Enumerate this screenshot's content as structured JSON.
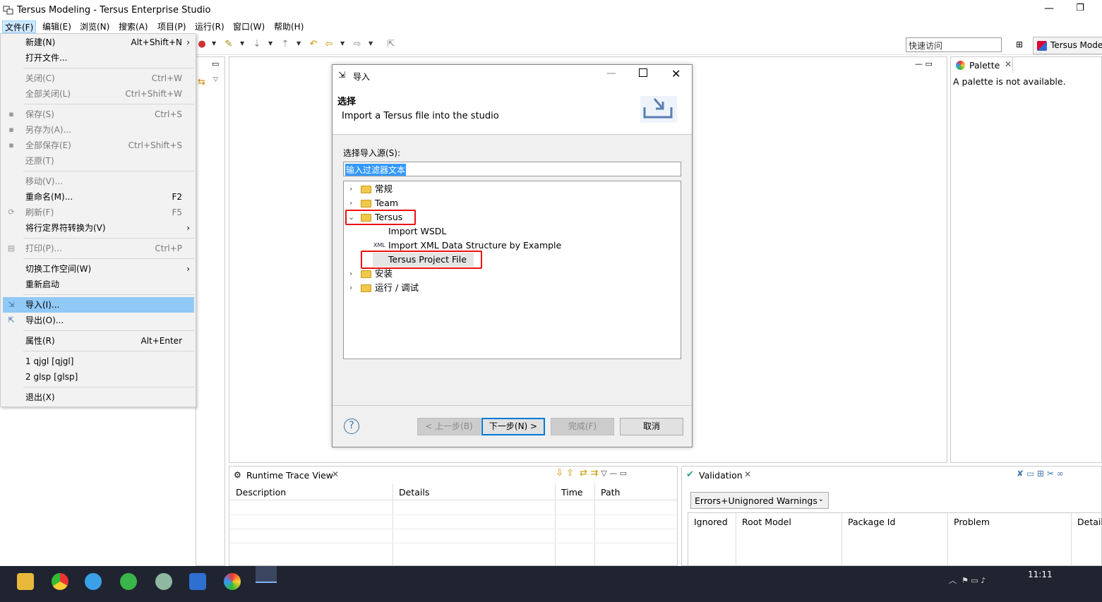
{
  "window": {
    "title": "Tersus Modeling - Tersus Enterprise Studio",
    "minimize": "—",
    "restore": "❐"
  },
  "menubar": [
    "文件(F)",
    "编辑(E)",
    "浏览(N)",
    "搜索(A)",
    "项目(P)",
    "运行(R)",
    "窗口(W)",
    "帮助(H)"
  ],
  "toolbar": {
    "quick_access_placeholder": "快速访问",
    "perspective": "Tersus Modeling"
  },
  "file_menu": [
    {
      "label": "新建(N)",
      "accel": "Alt+Shift+N",
      "submenu": true
    },
    {
      "label": "打开文件..."
    },
    {
      "label": "关闭(C)",
      "accel": "Ctrl+W",
      "disabled": true
    },
    {
      "label": "全部关闭(L)",
      "accel": "Ctrl+Shift+W",
      "disabled": true
    },
    {
      "label": "保存(S)",
      "accel": "Ctrl+S",
      "disabled": true
    },
    {
      "label": "另存为(A)...",
      "disabled": true
    },
    {
      "label": "全部保存(E)",
      "accel": "Ctrl+Shift+S",
      "disabled": true
    },
    {
      "label": "还原(T)",
      "disabled": true
    },
    {
      "label": "移动(V)...",
      "disabled": true
    },
    {
      "label": "重命名(M)...",
      "accel": "F2"
    },
    {
      "label": "刷新(F)",
      "accel": "F5",
      "disabled": true
    },
    {
      "label": "将行定界符转换为(V)",
      "submenu": true
    },
    {
      "label": "打印(P)...",
      "accel": "Ctrl+P",
      "disabled": true
    },
    {
      "label": "切换工作空间(W)",
      "submenu": true
    },
    {
      "label": "重新启动"
    },
    {
      "label": "导入(I)...",
      "highlighted": true
    },
    {
      "label": "导出(O)..."
    },
    {
      "label": "属性(R)",
      "accel": "Alt+Enter"
    },
    {
      "label": "1 qjgl  [qjgl]"
    },
    {
      "label": "2 glsp  [glsp]"
    },
    {
      "label": "退出(X)"
    }
  ],
  "dialog": {
    "title": "导入",
    "heading": "选择",
    "description": "Import a Tersus file into the studio",
    "source_label": "选择导入源(S):",
    "filter_text": "输入过滤器文本",
    "tree": [
      {
        "label": "常规",
        "expanded": false
      },
      {
        "label": "Team",
        "expanded": false
      },
      {
        "label": "Tersus",
        "expanded": true
      },
      {
        "label": "Import WSDL",
        "child": true
      },
      {
        "label": "Import XML Data Structure by Example",
        "child": true
      },
      {
        "label": "Tersus Project File",
        "child": true,
        "selected": true
      },
      {
        "label": "安装",
        "expanded": false
      },
      {
        "label": "运行 / 调试",
        "expanded": false
      }
    ],
    "buttons": {
      "back": "< 上一步(B)",
      "next": "下一步(N) >",
      "finish": "完成(F)",
      "cancel": "取消"
    }
  },
  "palette": {
    "tab": "Palette",
    "message": "A palette is not available."
  },
  "trace_view": {
    "tab": "Runtime Trace View",
    "columns": [
      "Description",
      "Details",
      "Time",
      "Path"
    ]
  },
  "validation": {
    "tab": "Validation",
    "filter": "Errors+Unignored Warnings",
    "columns": [
      "Ignored",
      "Root Model",
      "Package Id",
      "Problem",
      "Details"
    ]
  },
  "taskbar": {
    "clock": "11:11"
  }
}
